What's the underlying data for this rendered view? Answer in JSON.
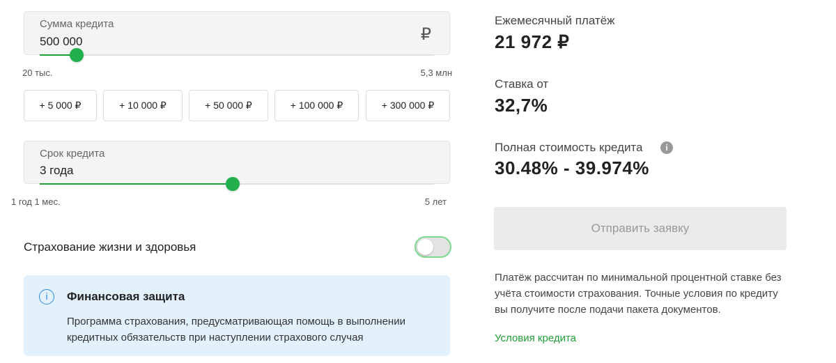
{
  "amount": {
    "label": "Сумма кредита",
    "value": "500 000",
    "currency_icon": "₽",
    "min": "20 тыс.",
    "max": "5,3 млн",
    "fraction": 0.094
  },
  "quick_add": [
    "+ 5 000 ₽",
    "+ 10 000 ₽",
    "+ 50 000 ₽",
    "+ 100 000 ₽",
    "+ 300 000 ₽"
  ],
  "term": {
    "label": "Срок кредита",
    "value": "3 года",
    "min": "1 год 1 мес.",
    "max": "5 лет",
    "fraction": 0.49
  },
  "insurance": {
    "label": "Страхование жизни и здоровья",
    "enabled": false
  },
  "info": {
    "title": "Финансовая защита",
    "text": "Программа страхования, предусматривающая помощь в выполнении кредитных обязательств при наступлении страхового случая"
  },
  "summary": {
    "monthly_label": "Ежемесячный платёж",
    "monthly_value": "21 972 ₽",
    "rate_label": "Ставка от",
    "rate_value": "32,7%",
    "full_cost_label": "Полная стоимость кредита",
    "full_cost_value": "30.48% - 39.974%",
    "submit_label": "Отправить заявку",
    "note": "Платёж рассчитан по минимальной процентной ставке без учёта стоимости страхования. Точные условия по кредиту вы получите после подачи пакета документов.",
    "conditions_link": "Условия кредита"
  },
  "colors": {
    "accent": "#21a038",
    "info_bg": "#e3f1fd",
    "info_icon": "#2a8ae6"
  }
}
